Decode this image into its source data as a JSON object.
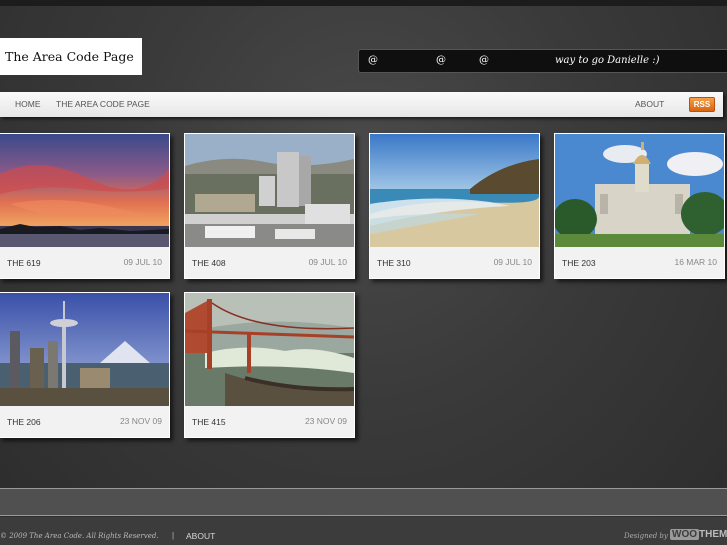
{
  "site": {
    "title": "The Area Code Page"
  },
  "twitter": {
    "at1": "@",
    "at2": "@",
    "at3": "@",
    "tweet": "way to go Danielle :)"
  },
  "nav": {
    "home": "HOME",
    "area_code_page": "THE AREA CODE PAGE",
    "about": "ABOUT",
    "rss": "RSS"
  },
  "posts": [
    {
      "title": "THE 619",
      "date": "09 JUL 10",
      "image": "sunset-over-water-photo"
    },
    {
      "title": "THE 408",
      "date": "09 JUL 10",
      "image": "city-skyline-photo"
    },
    {
      "title": "THE 310",
      "date": "09 JUL 10",
      "image": "beach-coastline-photo"
    },
    {
      "title": "THE 203",
      "date": "16 MAR 10",
      "image": "capitol-building-photo"
    },
    {
      "title": "THE 206",
      "date": "23 NOV 09",
      "image": "space-needle-photo"
    },
    {
      "title": "THE 415",
      "date": "23 NOV 09",
      "image": "golden-gate-bridge-photo"
    }
  ],
  "footer": {
    "copyright": "© 2009 The Area Code. All Rights Reserved.",
    "separator": "|",
    "about": "ABOUT",
    "designed_by": "Designed by",
    "woo": "WOO",
    "themes": "THEMES"
  }
}
